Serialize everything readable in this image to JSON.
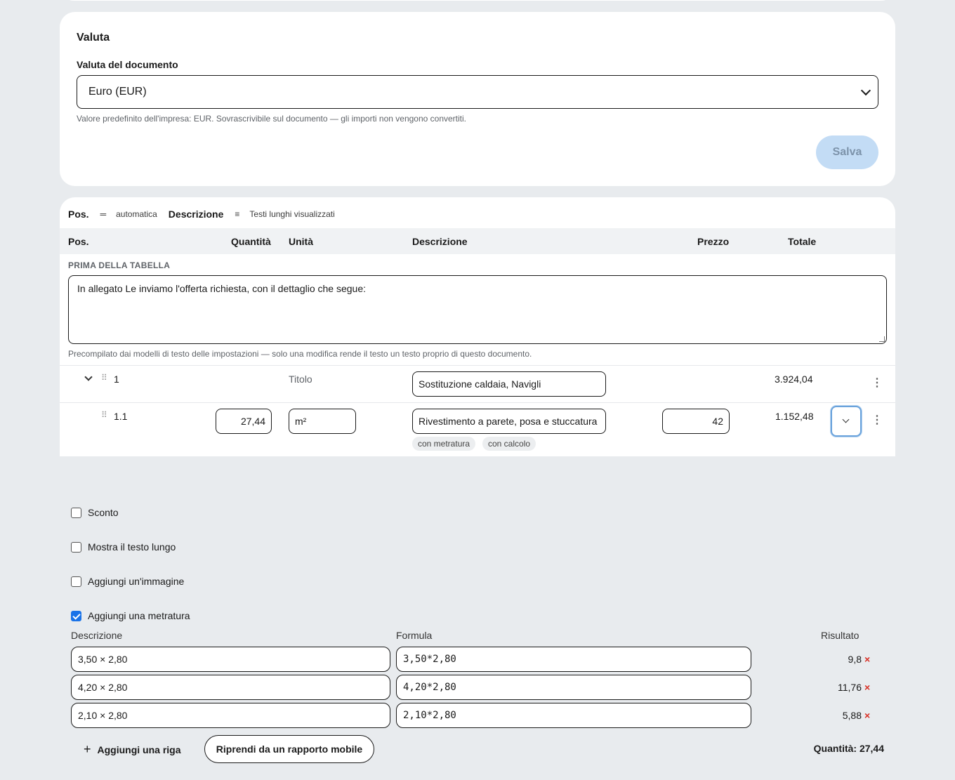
{
  "valuta": {
    "title": "Valuta",
    "field_label": "Valuta del documento",
    "selected": "Euro (EUR)",
    "hint": "Valore predefinito dell'impresa: EUR. Sovrascrivibile sul documento — gli importi non vengono convertiti.",
    "save_label": "Salva"
  },
  "toolbar": {
    "pos_label": "Pos.",
    "pos_value": "automatica",
    "desc_label": "Descrizione",
    "desc_value": "Testi lunghi visualizzati"
  },
  "table": {
    "headers": {
      "pos": "Pos.",
      "quantity": "Quantità",
      "unit": "Unità",
      "description": "Descrizione",
      "price": "Prezzo",
      "total": "Totale"
    },
    "before_label": "PRIMA DELLA TABELLA",
    "before_text": "In allegato Le inviamo l'offerta richiesta, con il dettaglio che segue:",
    "before_hint": "Precompilato dai modelli di testo delle impostazioni — solo una modifica rende il testo un testo proprio di questo documento.",
    "rows": [
      {
        "pos": "1",
        "unit": "Titolo",
        "description": "Sostituzione caldaia, Navigli",
        "total": "3.924,04"
      },
      {
        "pos": "1.1",
        "quantity": "27,44",
        "unit": "m²",
        "description": "Rivestimento a parete, posa e stuccatura",
        "price": "42",
        "total": "1.152,48",
        "chips": [
          "con metratura",
          "con calcolo"
        ]
      }
    ]
  },
  "options": {
    "discount": "Sconto",
    "long_text": "Mostra il testo lungo",
    "add_image": "Aggiungi un'immagine",
    "add_measure": "Aggiungi una metratura",
    "add_measure_checked": true
  },
  "measure": {
    "headers": {
      "description": "Descrizione",
      "formula": "Formula",
      "result": "Risultato"
    },
    "rows": [
      {
        "description": "3,50 × 2,80",
        "formula": "3,50*2,80",
        "result": "9,8"
      },
      {
        "description": "4,20 × 2,80",
        "formula": "4,20*2,80",
        "result": "11,76"
      },
      {
        "description": "2,10 × 2,80",
        "formula": "2,10*2,80",
        "result": "5,88"
      }
    ],
    "delete_symbol": "×",
    "add_row": "Aggiungi una riga",
    "import_button": "Riprendi da un rapporto mobile",
    "total": "Quantità: 27,44"
  }
}
